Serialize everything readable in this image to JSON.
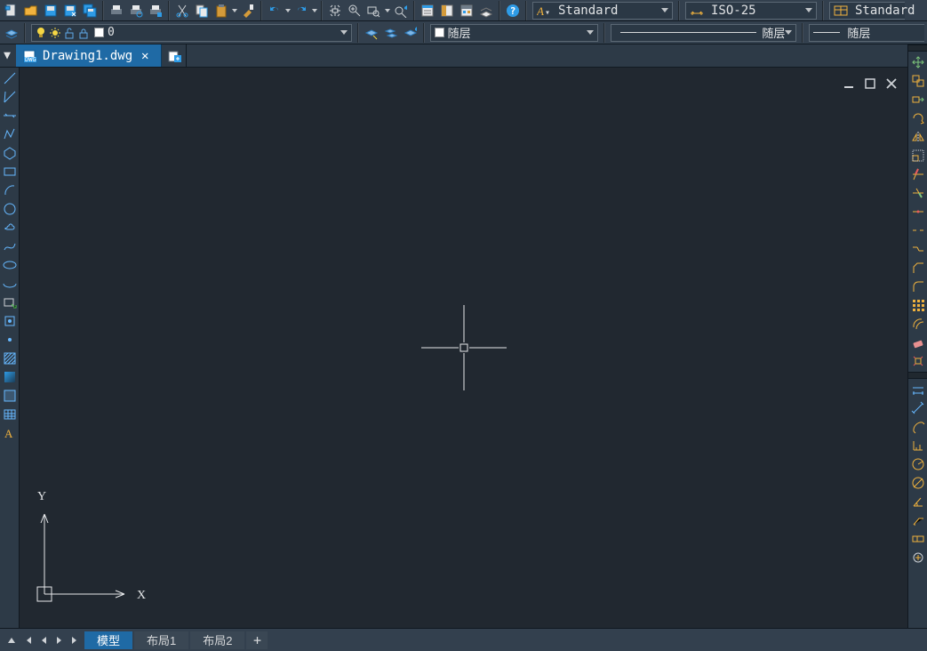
{
  "toolbar1": {
    "style_combo": {
      "prefix_icon": "text-style-icon",
      "value": "Standard"
    },
    "dimstyle_combo": {
      "prefix_icon": "dim-style-icon",
      "value": "ISO-25"
    },
    "tablestyle_combo": {
      "prefix_icon": "table-style-icon",
      "value": "Standard"
    }
  },
  "toolbar2": {
    "layer_combo": {
      "color_swatch": "#ffffff",
      "value": "0"
    },
    "color_combo": {
      "color_swatch": "#ffffff",
      "value": "随层"
    },
    "linetype_combo": {
      "value": "随层"
    },
    "lineweight_combo": {
      "value": "随层"
    }
  },
  "doc_tab": {
    "filename": "Drawing1.dwg",
    "file_icon": "dwg-file-icon"
  },
  "canvas": {
    "ucs_x": "X",
    "ucs_y": "Y"
  },
  "bottom_tabs": {
    "model": "模型",
    "layout1": "布局1",
    "layout2": "布局2",
    "add": "+"
  },
  "icons": {
    "left": [
      "line-tool",
      "ray-tool",
      "xline-tool",
      "polyline-tool",
      "polygon-tool",
      "rectangle-tool",
      "arc-tool",
      "circle-tool",
      "revcloud-tool",
      "spline-tool",
      "ellipse-tool",
      "ellipse-arc-tool",
      "insert-block-tool",
      "make-block-tool",
      "point-tool",
      "hatch-tool",
      "gradient-tool",
      "region-tool",
      "table-tool",
      "mtext-tool"
    ],
    "top": [
      "new-icon",
      "open-icon",
      "save-icon",
      "saveas-icon",
      "saveall-icon",
      "print-icon",
      "print-preview-icon",
      "plot-icon",
      "cut-icon",
      "copy-icon",
      "paste-icon",
      "matchprop-icon",
      "undo-icon",
      "redo-icon",
      "pan-icon",
      "zoom-realtime-icon",
      "zoom-window-icon",
      "zoom-prev-icon",
      "properties-icon",
      "designcenter-icon",
      "toolpalettes-icon",
      "sheetset-icon",
      "help-icon"
    ],
    "right_a": [
      "move-tool-icon",
      "copy-tool-icon",
      "stretch-tool-icon",
      "rotate-tool-icon",
      "mirror-tool-icon",
      "scale-tool-icon",
      "trim-tool-icon",
      "extend-tool-icon",
      "break-at-point-icon",
      "break-tool-icon",
      "join-tool-icon",
      "chamfer-tool-icon",
      "fillet-tool-icon",
      "array-tool-icon",
      "offset-tool-icon",
      "erase-tool-icon",
      "explode-tool-icon"
    ],
    "right_b": [
      "linear-dim-icon",
      "aligned-dim-icon",
      "arc-dim-icon",
      "ordinate-dim-icon",
      "radius-dim-icon",
      "diameter-dim-icon",
      "angular-dim-icon",
      "qleader-icon",
      "tolerance-dim-icon",
      "center-mark-icon"
    ],
    "layer_tools": [
      "layer-manager-icon",
      "layer-previous-icon",
      "layer-state-icon"
    ],
    "row2_icons": [
      "isolate-layer-icon",
      "light-bulb-icon",
      "freeze-layer-icon",
      "lock-layer-icon",
      "layer-color-icon"
    ],
    "row2_right_icons": [
      "make-current-icon",
      "layer-match-icon",
      "layer-previous2-icon"
    ]
  }
}
